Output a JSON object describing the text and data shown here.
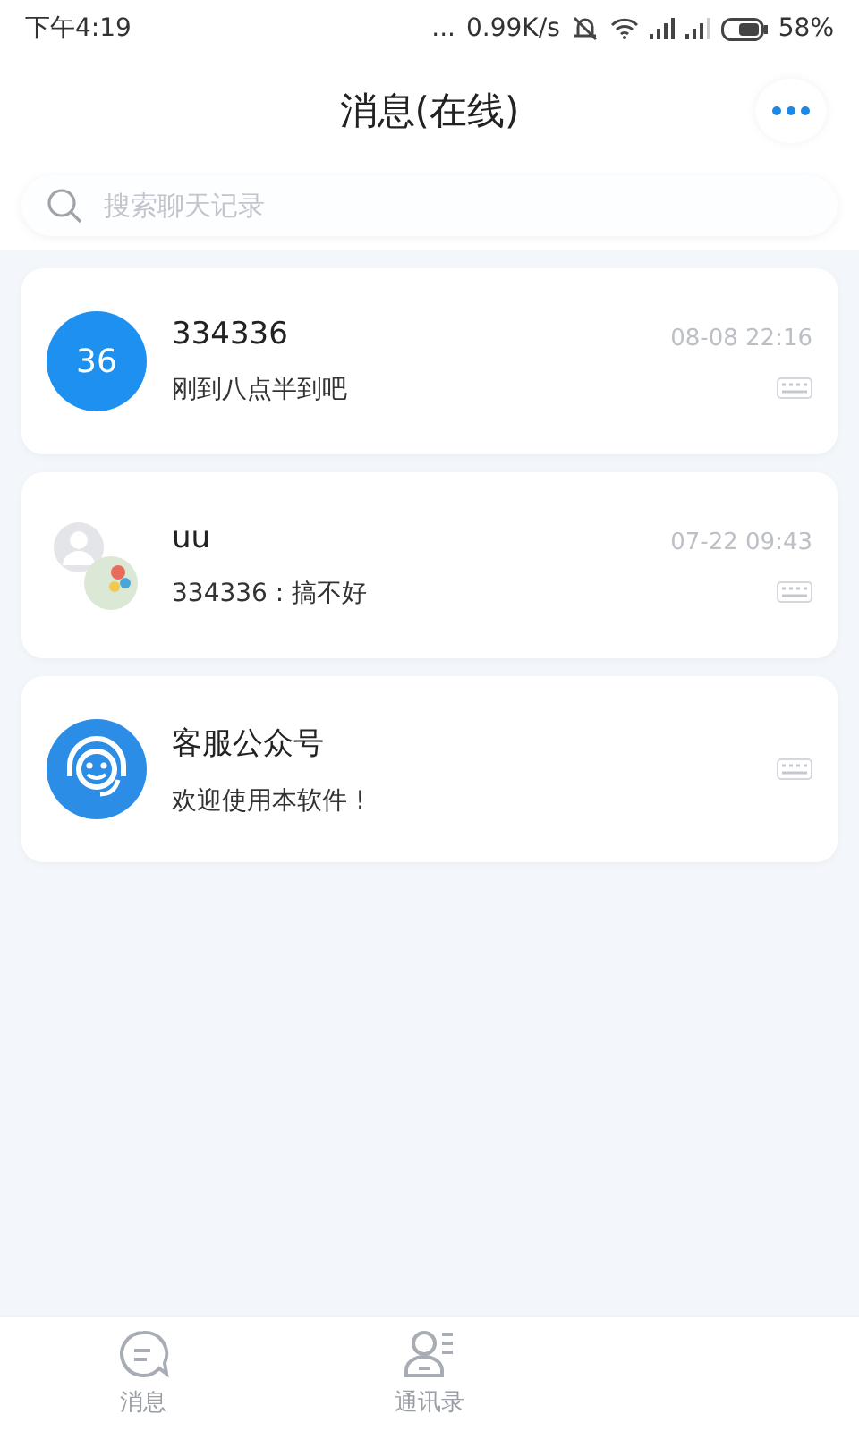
{
  "status_bar": {
    "time": "下午4:19",
    "more": "...",
    "speed": "0.99K/s",
    "battery": "58%"
  },
  "header": {
    "title": "消息(在线)"
  },
  "search": {
    "placeholder": "搜索聊天记录"
  },
  "conversations": [
    {
      "avatar": {
        "kind": "initials",
        "text": "36"
      },
      "name": "334336",
      "message": "刚到八点半到吧",
      "time": "08-08 22:16"
    },
    {
      "avatar": {
        "kind": "group"
      },
      "name": "uu",
      "message": "334336 : 搞不好",
      "time": "07-22 09:43"
    },
    {
      "avatar": {
        "kind": "service"
      },
      "name": "客服公众号",
      "message": "欢迎使用本软件 !"
    }
  ],
  "tab_bar": [
    {
      "kind": "chat",
      "label": "消息"
    },
    {
      "kind": "contacts",
      "label": "通讯录"
    }
  ]
}
